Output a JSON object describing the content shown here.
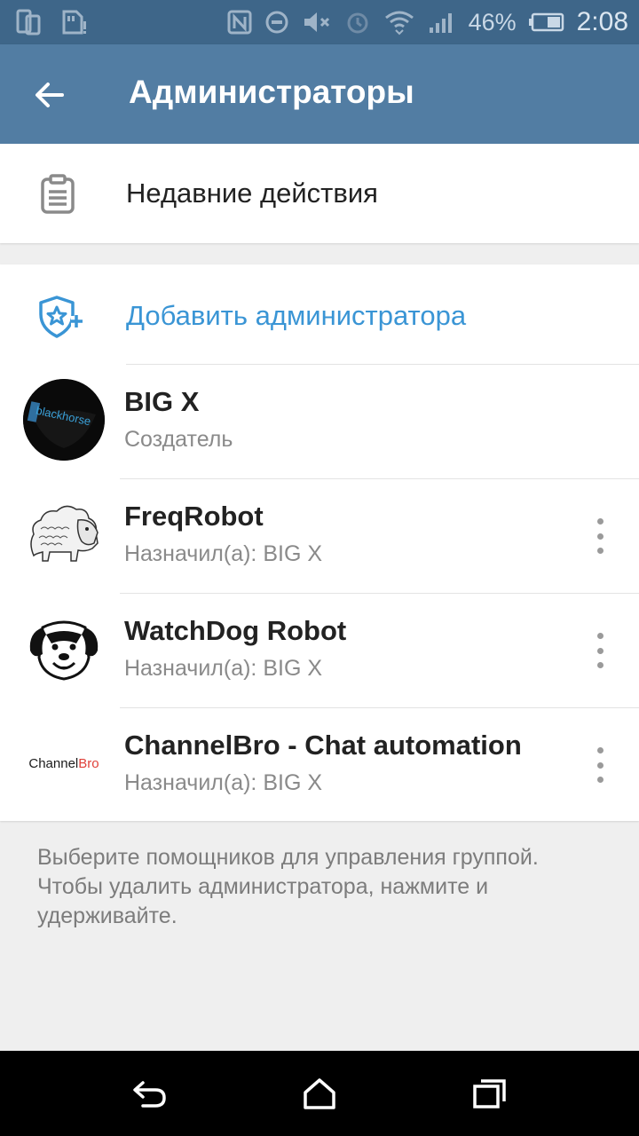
{
  "status_bar": {
    "battery_percent": "46%",
    "time": "2:08"
  },
  "app_bar": {
    "title": "Администраторы"
  },
  "recent_actions": {
    "label": "Недавние действия"
  },
  "add_admin": {
    "label": "Добавить администратора"
  },
  "admins": [
    {
      "name": "BIG X",
      "role": "Создатель",
      "avatar_text": "blackhorse"
    },
    {
      "name": "FreqRobot",
      "role": "Назначил(а): BIG X"
    },
    {
      "name": "WatchDog Robot",
      "role": "Назначил(а): BIG X"
    },
    {
      "name": "ChannelBro - Chat automation",
      "role": "Назначил(а): BIG X",
      "avatar_text_a": "Channel",
      "avatar_text_b": "Bro"
    }
  ],
  "hint": "Выберите помощников для управления группой. Чтобы удалить администратора, нажмите и удерживайте.",
  "colors": {
    "status_bar": "#3e6689",
    "app_bar": "#527da3",
    "accent": "#3a95d5"
  }
}
